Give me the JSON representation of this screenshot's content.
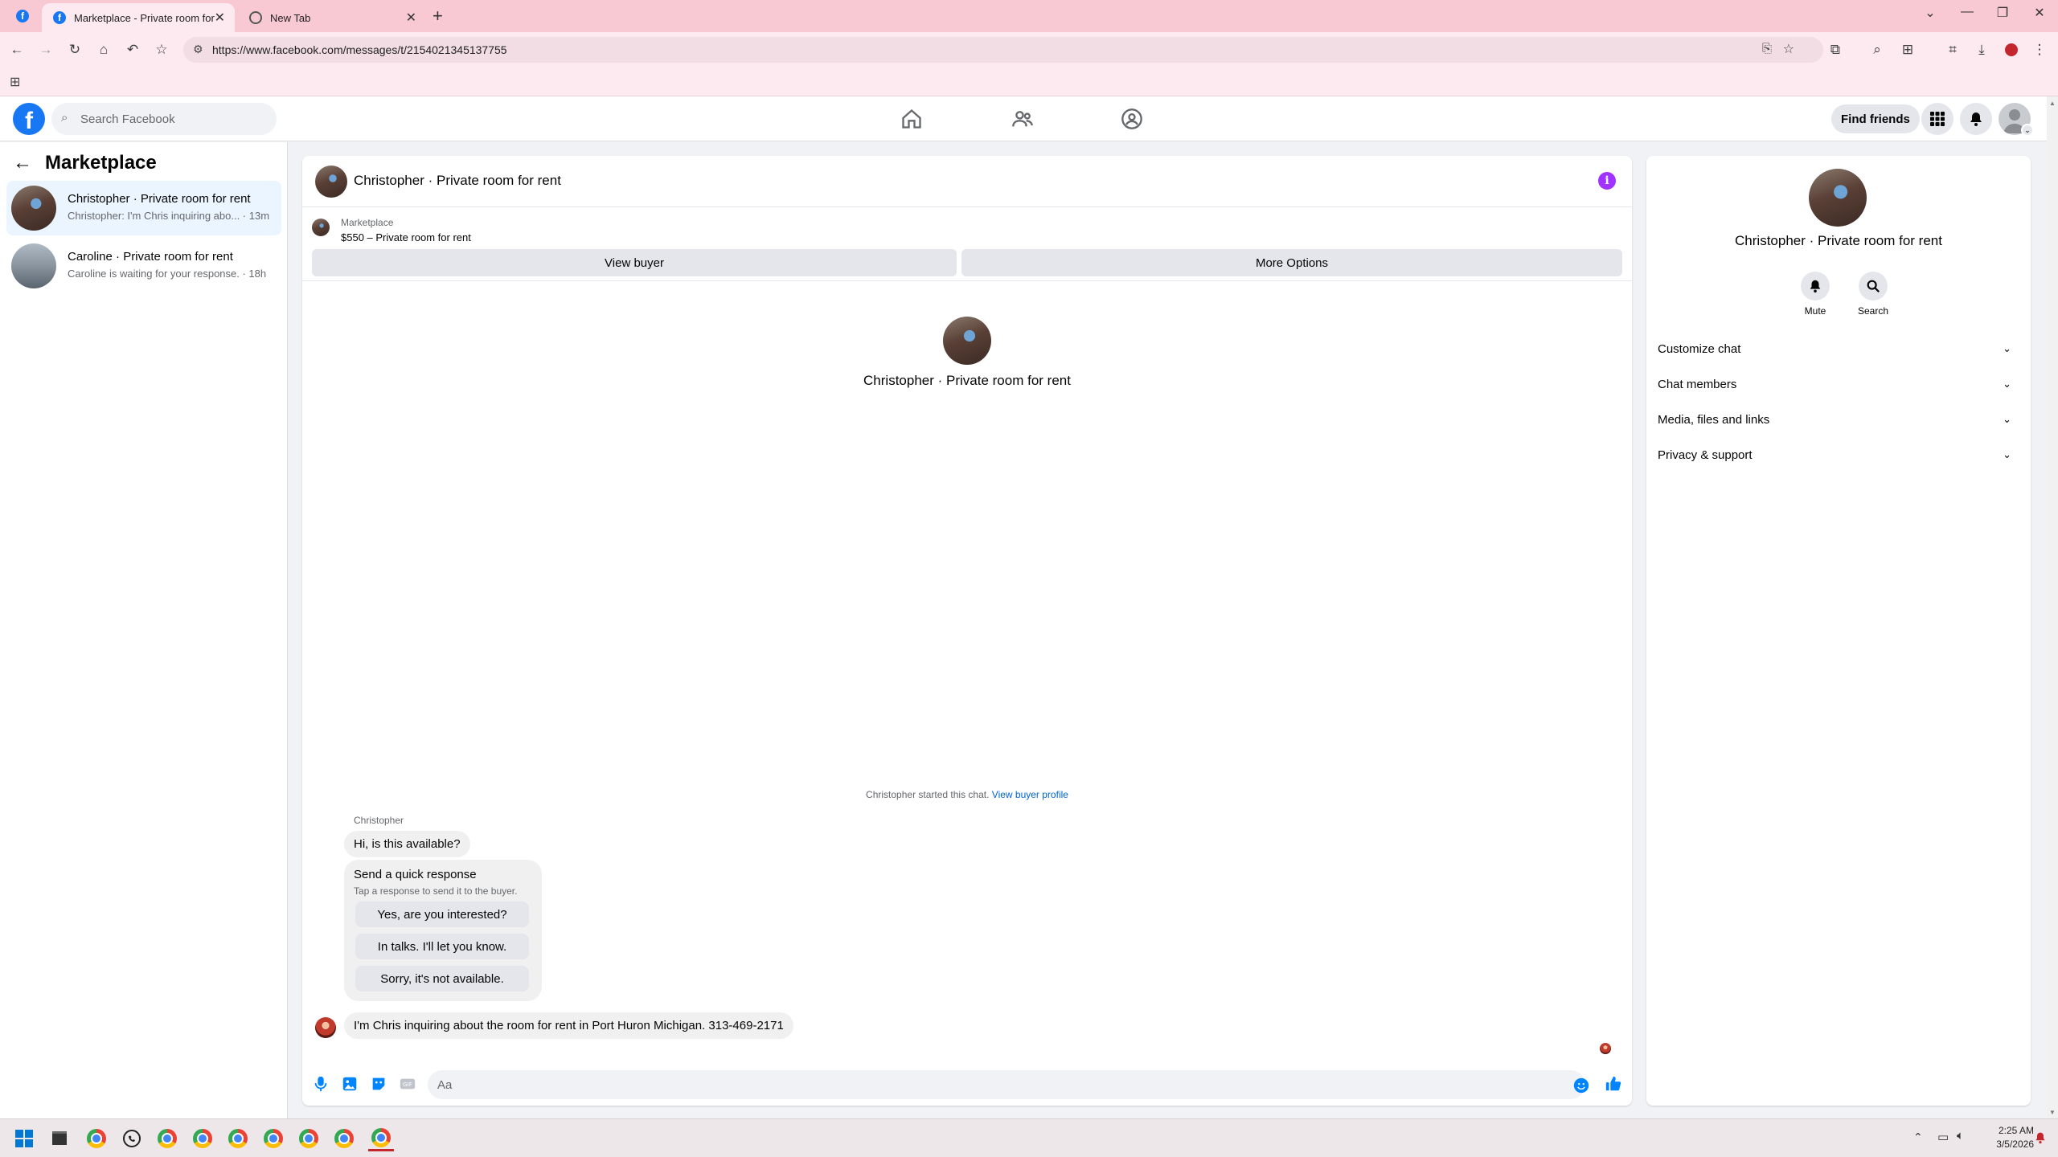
{
  "browser": {
    "tabs": [
      {
        "title": "Marketplace - Private room for"
      },
      {
        "title": "New Tab"
      }
    ],
    "url": "https://www.facebook.com/messages/t/2154021345137755"
  },
  "fb": {
    "search_placeholder": "Search Facebook",
    "find_friends": "Find friends"
  },
  "left": {
    "title": "Marketplace",
    "conversations": [
      {
        "name": "Christopher · Private room for rent",
        "preview": "Christopher: I'm Chris inquiring abo... · 13m"
      },
      {
        "name": "Caroline · Private room for rent",
        "preview": "Caroline is waiting for your response. · 18h"
      }
    ]
  },
  "chat": {
    "title": "Christopher · Private room for rent",
    "marketplace_label": "Marketplace",
    "listing": "$550 – Private room for rent",
    "view_buyer": "View buyer",
    "more_options": "More Options",
    "intro_name": "Christopher · Private room for rent",
    "started_text": "Christopher started this chat.",
    "view_buyer_profile": "View buyer profile",
    "sender_name": "Christopher",
    "message1": "Hi, is this available?",
    "quick_title": "Send a quick response",
    "quick_sub": "Tap a response to send it to the buyer.",
    "quick_options": [
      "Yes, are you interested?",
      "In talks. I'll let you know.",
      "Sorry, it's not available."
    ],
    "message2": "I'm Chris inquiring about the room for rent in Port Huron Michigan. 313-469-2171",
    "composer_placeholder": "Aa"
  },
  "right": {
    "name": "Christopher · Private room for rent",
    "mute": "Mute",
    "search": "Search",
    "sections": [
      "Customize chat",
      "Chat members",
      "Media, files and links",
      "Privacy & support"
    ]
  },
  "taskbar": {
    "time": "2:25 AM",
    "date": "3/5/2026"
  },
  "colors": {
    "fb_blue": "#1877f2",
    "messenger_blue": "#0084ff",
    "info_purple": "#a033ff",
    "tabbar_pink": "#f8c8d3"
  }
}
